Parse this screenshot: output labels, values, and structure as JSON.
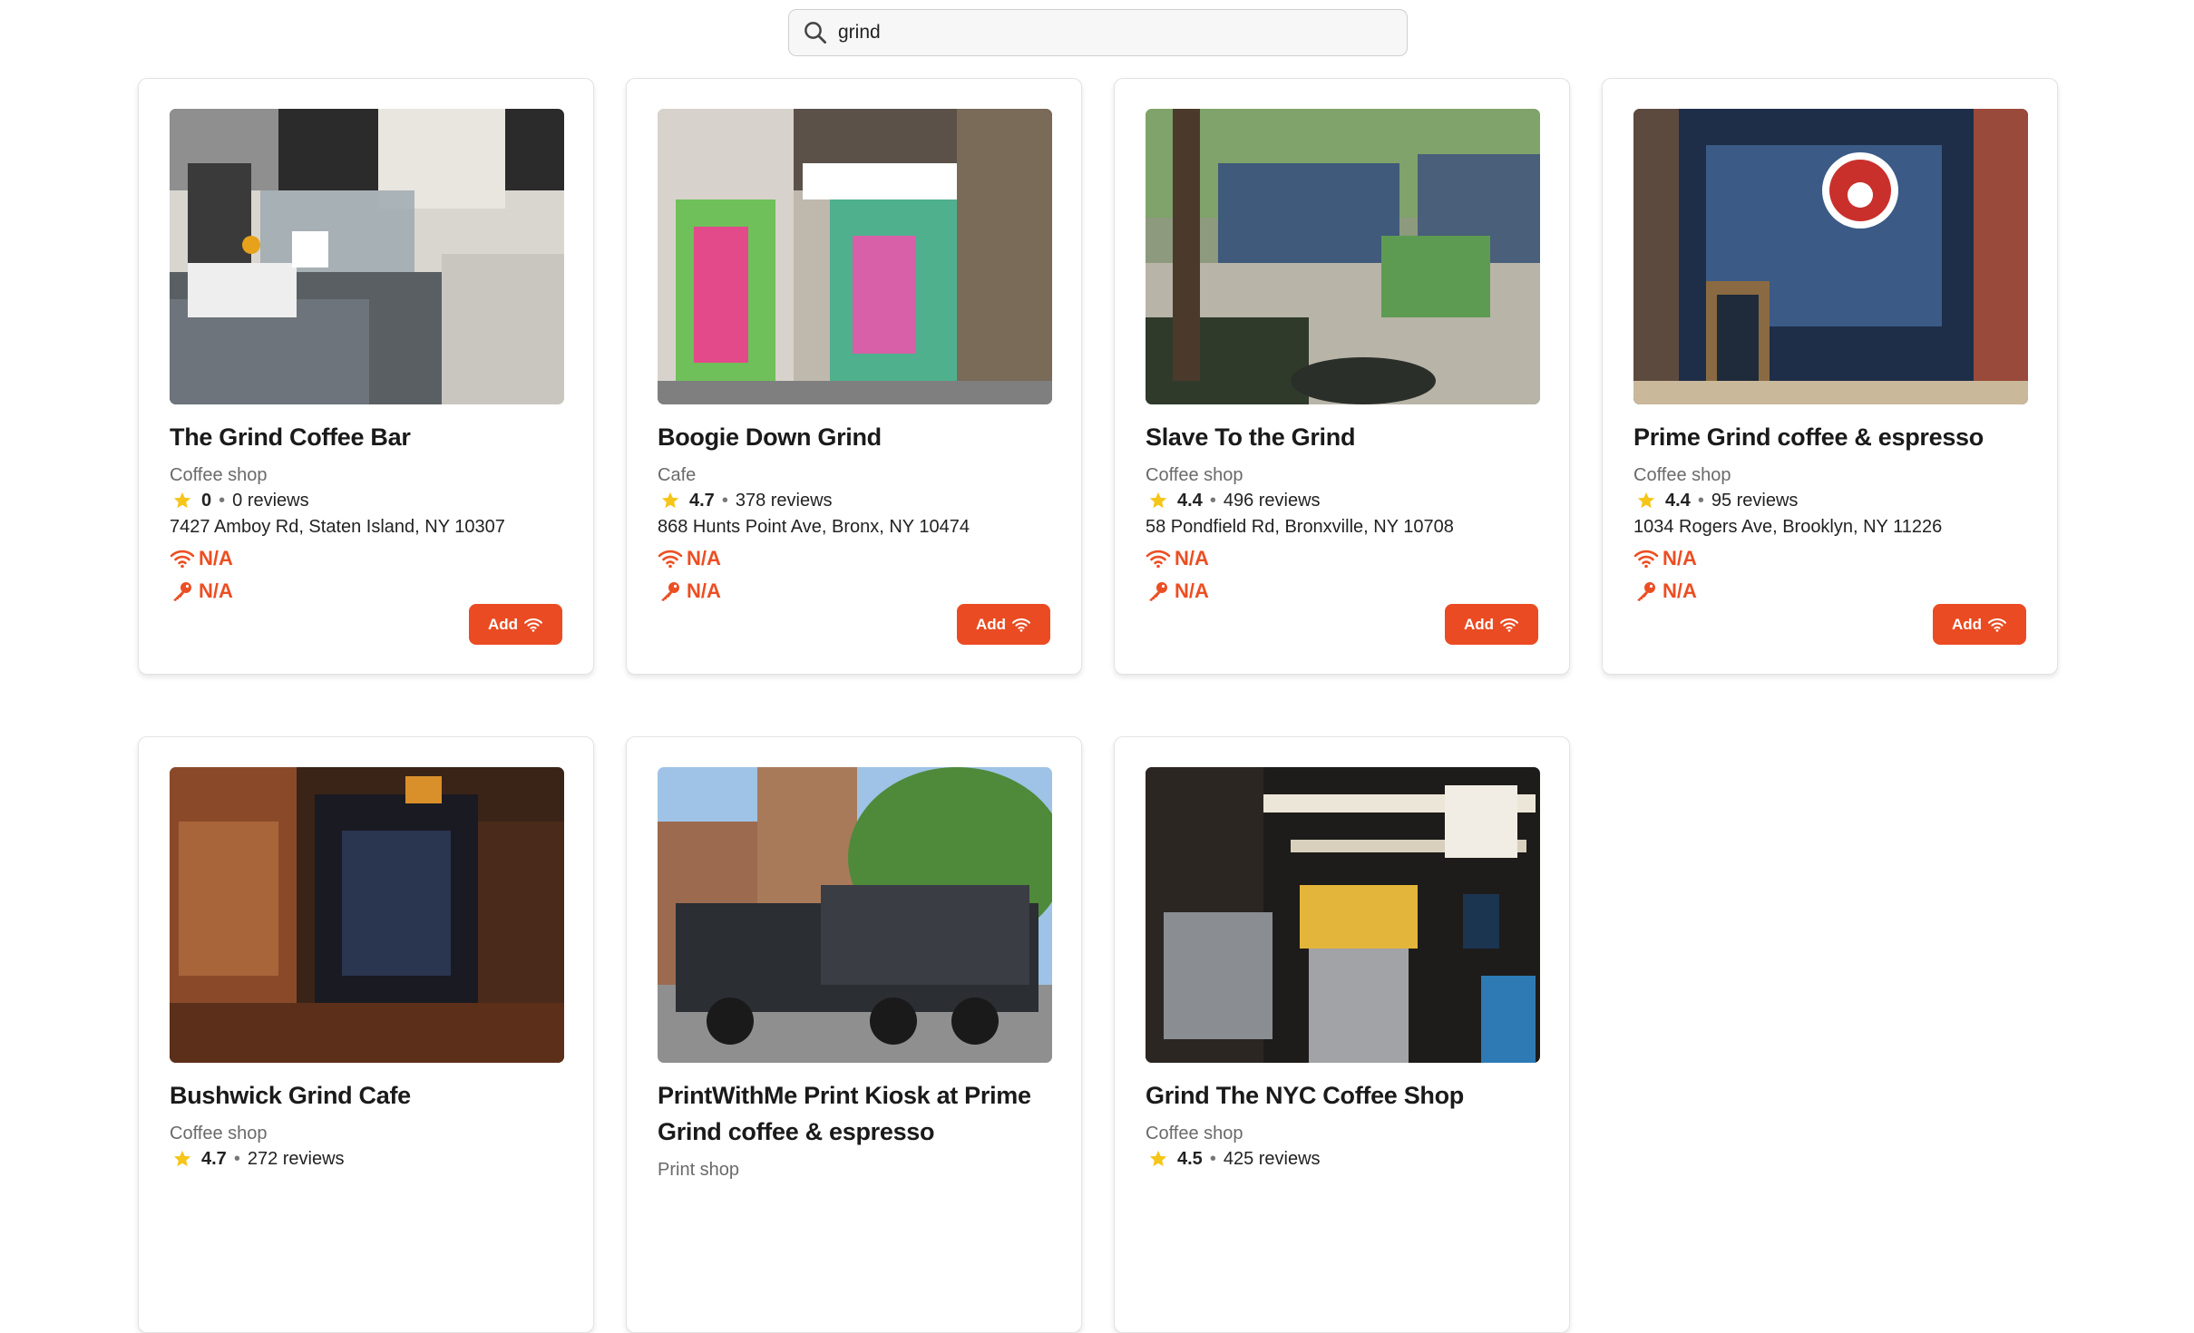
{
  "search": {
    "value": "grind",
    "icon": "search-icon"
  },
  "colors": {
    "accent": "#ea4b22",
    "text": "#1f1f1f",
    "muted": "#6a6a6a",
    "star": "#f5c518"
  },
  "cards": [
    {
      "title": "The Grind Coffee Bar",
      "category": "Coffee shop",
      "rating": "0",
      "reviews": "0 reviews",
      "address": "7427 Amboy Rd, Staten Island, NY 10307",
      "wifi": "N/A",
      "password": "N/A",
      "add_label": "Add"
    },
    {
      "title": "Boogie Down Grind",
      "category": "Cafe",
      "rating": "4.7",
      "reviews": "378 reviews",
      "address": "868 Hunts Point Ave, Bronx, NY 10474",
      "wifi": "N/A",
      "password": "N/A",
      "add_label": "Add"
    },
    {
      "title": "Slave To the Grind",
      "category": "Coffee shop",
      "rating": "4.4",
      "reviews": "496 reviews",
      "address": "58 Pondfield Rd, Bronxville, NY 10708",
      "wifi": "N/A",
      "password": "N/A",
      "add_label": "Add"
    },
    {
      "title": "Prime Grind coffee & espresso",
      "category": "Coffee shop",
      "rating": "4.4",
      "reviews": "95 reviews",
      "address": "1034 Rogers Ave, Brooklyn, NY 11226",
      "wifi": "N/A",
      "password": "N/A",
      "add_label": "Add"
    },
    {
      "title": "Bushwick Grind Cafe",
      "category": "Coffee shop",
      "rating": "4.7",
      "reviews": "272 reviews"
    },
    {
      "title": "PrintWithMe Print Kiosk at Prime Grind coffee & espresso",
      "category": "Print shop"
    },
    {
      "title": "Grind The NYC Coffee Shop",
      "category": "Coffee shop",
      "rating": "4.5",
      "reviews": "425 reviews"
    }
  ]
}
